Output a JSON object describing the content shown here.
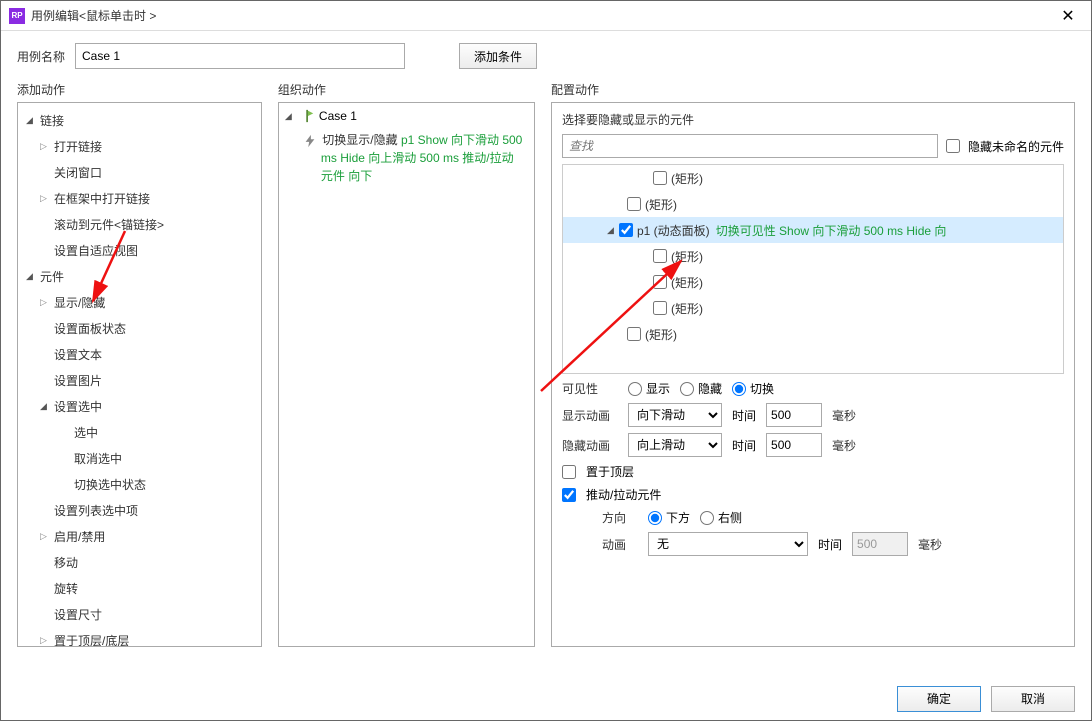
{
  "titlebar": {
    "app_badge": "RP",
    "title": "用例编辑<鼠标单击时 >"
  },
  "name_row": {
    "label": "用例名称",
    "value": "Case 1",
    "add_condition": "添加条件"
  },
  "columns": {
    "add_action": "添加动作",
    "organize": "组织动作",
    "configure": "配置动作"
  },
  "tree": {
    "links": {
      "label": "链接",
      "open_link": "打开链接",
      "close_window": "关闭窗口",
      "open_in_frame": "在框架中打开链接",
      "scroll_anchor": "滚动到元件<锚链接>",
      "adaptive": "设置自适应视图"
    },
    "widgets": {
      "label": "元件",
      "show_hide": "显示/隐藏",
      "panel_state": "设置面板状态",
      "set_text": "设置文本",
      "set_image": "设置图片",
      "set_selected": {
        "label": "设置选中",
        "select": "选中",
        "unselect": "取消选中",
        "toggle": "切换选中状态"
      },
      "list_selected": "设置列表选中项",
      "enable_disable": "启用/禁用",
      "move": "移动",
      "rotate": "旋转",
      "resize": "设置尺寸",
      "bring_front": "置于顶层/底层"
    }
  },
  "organize": {
    "case_label": "Case 1",
    "action_prefix": "切换显示/隐藏",
    "action_green1": "p1 Show 向下滑动 500 ms Hide 向上滑动 500 ms 推动/拉动 元件 向下"
  },
  "configure": {
    "title": "选择要隐藏或显示的元件",
    "search_placeholder": "查找",
    "hide_unnamed": "隐藏未命名的元件",
    "widgets": {
      "rect": "(矩形)",
      "p1_label": "p1 (动态面板)",
      "p1_desc": "切换可见性 Show 向下滑动 500 ms Hide 向"
    },
    "visibility": {
      "label": "可见性",
      "show": "显示",
      "hide": "隐藏",
      "toggle": "切换"
    },
    "show_anim": {
      "label": "显示动画",
      "value": "向下滑动",
      "time_label": "时间",
      "time": "500",
      "unit": "毫秒"
    },
    "hide_anim": {
      "label": "隐藏动画",
      "value": "向上滑动",
      "time_label": "时间",
      "time": "500",
      "unit": "毫秒"
    },
    "bring_top": "置于顶层",
    "push_pull": "推动/拉动元件",
    "direction": {
      "label": "方向",
      "down": "下方",
      "right": "右侧"
    },
    "push_anim": {
      "label": "动画",
      "value": "无",
      "time_label": "时间",
      "time": "500",
      "unit": "毫秒"
    }
  },
  "footer": {
    "ok": "确定",
    "cancel": "取消"
  }
}
